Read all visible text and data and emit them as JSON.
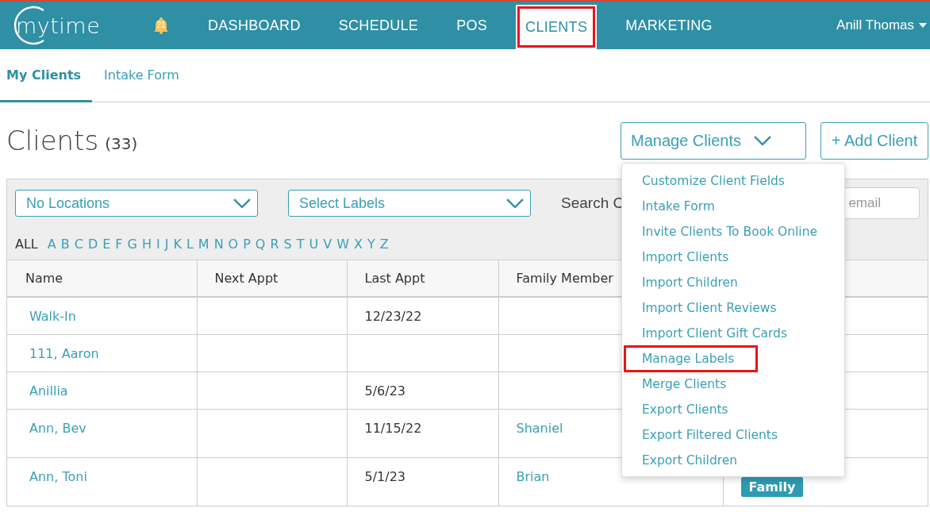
{
  "topbar": {
    "logo": "mytime",
    "notifications": "21",
    "nav": [
      {
        "label": "DASHBOARD",
        "selected": false,
        "highlighted": false
      },
      {
        "label": "SCHEDULE",
        "selected": false,
        "highlighted": false
      },
      {
        "label": "POS",
        "selected": false,
        "highlighted": false
      },
      {
        "label": "CLIENTS",
        "selected": true,
        "highlighted": true
      },
      {
        "label": "MARKETING",
        "selected": false,
        "highlighted": false
      }
    ],
    "user": "Anill Thomas"
  },
  "subtabs": [
    {
      "label": "My Clients",
      "selected": true
    },
    {
      "label": "Intake Form",
      "selected": false
    }
  ],
  "header": {
    "title": "Clients",
    "count": "(33)",
    "manage_button": "Manage Clients",
    "add_button": "+ Add Client"
  },
  "filters": {
    "locations": "No Locations",
    "labels": "Select Labels",
    "search_label": "Search C",
    "search_placeholder": "email",
    "letters": [
      {
        "label": "ALL",
        "selected": true
      },
      {
        "label": "A",
        "selected": false
      },
      {
        "label": "B",
        "selected": false
      },
      {
        "label": "C",
        "selected": false
      },
      {
        "label": "D",
        "selected": false
      },
      {
        "label": "E",
        "selected": false
      },
      {
        "label": "F",
        "selected": false
      },
      {
        "label": "G",
        "selected": false
      },
      {
        "label": "H",
        "selected": false
      },
      {
        "label": "I",
        "selected": false
      },
      {
        "label": "J",
        "selected": false
      },
      {
        "label": "K",
        "selected": false
      },
      {
        "label": "L",
        "selected": false
      },
      {
        "label": "M",
        "selected": false
      },
      {
        "label": "N",
        "selected": false
      },
      {
        "label": "O",
        "selected": false
      },
      {
        "label": "P",
        "selected": false
      },
      {
        "label": "Q",
        "selected": false
      },
      {
        "label": "R",
        "selected": false
      },
      {
        "label": "S",
        "selected": false
      },
      {
        "label": "T",
        "selected": false
      },
      {
        "label": "U",
        "selected": false
      },
      {
        "label": "V",
        "selected": false
      },
      {
        "label": "W",
        "selected": false
      },
      {
        "label": "X",
        "selected": false
      },
      {
        "label": "Y",
        "selected": false
      },
      {
        "label": "Z",
        "selected": false
      }
    ]
  },
  "table": {
    "columns": [
      "Name",
      "Next Appt",
      "Last Appt",
      "Family Member"
    ],
    "rows": [
      {
        "name": "Walk-In",
        "next_appt": "",
        "last_appt": "12/23/22",
        "family_member": ""
      },
      {
        "name": "111, Aaron",
        "next_appt": "",
        "last_appt": "",
        "family_member": ""
      },
      {
        "name": "Anillia",
        "next_appt": "",
        "last_appt": "5/6/23",
        "family_member": ""
      },
      {
        "name": "Ann, Bev",
        "next_appt": "",
        "last_appt": "11/15/22",
        "family_member": "Shaniel"
      },
      {
        "name": "Ann, Toni",
        "next_appt": "",
        "last_appt": "5/1/23",
        "family_member": "Brian",
        "tag": "Family"
      }
    ]
  },
  "manage_menu": {
    "items": [
      {
        "label": "Customize Client Fields",
        "highlighted": false
      },
      {
        "label": "Intake Form",
        "highlighted": false
      },
      {
        "label": "Invite Clients To Book Online",
        "highlighted": false
      },
      {
        "label": "Import Clients",
        "highlighted": false
      },
      {
        "label": "Import Children",
        "highlighted": false
      },
      {
        "label": "Import Client Reviews",
        "highlighted": false
      },
      {
        "label": "Import Client Gift Cards",
        "highlighted": false
      },
      {
        "label": "Manage Labels",
        "highlighted": true
      },
      {
        "label": "Merge Clients",
        "highlighted": false
      },
      {
        "label": "Export Clients",
        "highlighted": false
      },
      {
        "label": "Export Filtered Clients",
        "highlighted": false
      },
      {
        "label": "Export Children",
        "highlighted": false
      }
    ]
  }
}
